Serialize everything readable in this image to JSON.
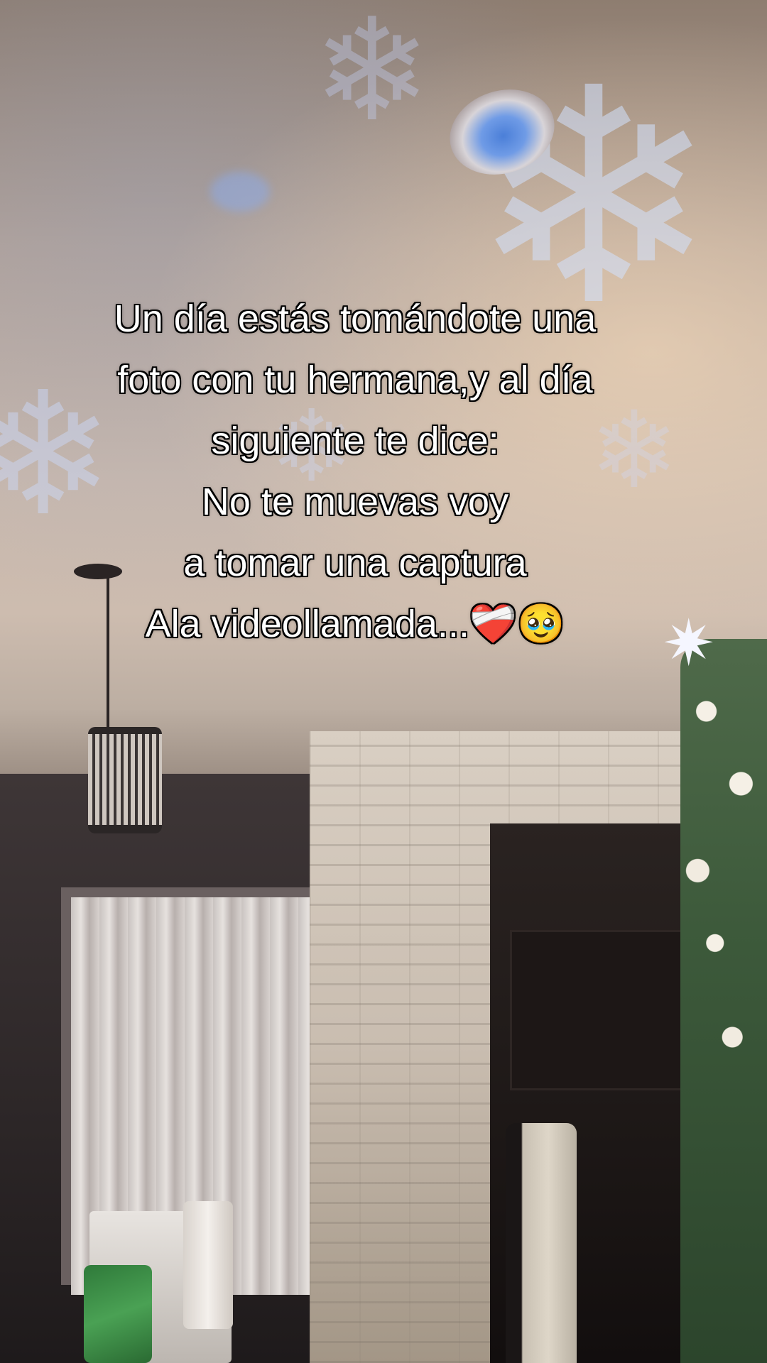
{
  "video": {
    "caption_lines": [
      "Un día estás tomándote una",
      "foto con tu hermana,y al día",
      "siguiente te dice:",
      "No te muevas voy",
      "a tomar una captura",
      "Ala videollamada..."
    ],
    "caption_emojis": "❤️‍🩹🥹"
  },
  "scene_colors": {
    "ceiling": "#c8b8ad",
    "wall_stone": "#d9cfc3",
    "snowflake_projection": "#d2e1ff",
    "tree_green": "#3d5a3b"
  }
}
